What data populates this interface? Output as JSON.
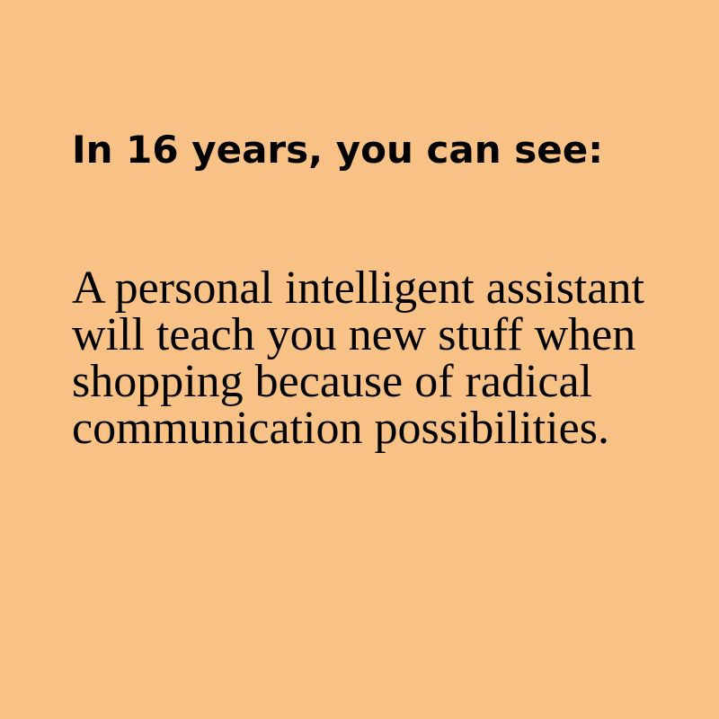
{
  "card": {
    "background_color": "#f8c286",
    "text_color": "#000000",
    "headline": "In 16 years, you can see:",
    "body": "A personal intelligent assistant will teach you new stuff when shopping because of radical communication possibilities."
  }
}
